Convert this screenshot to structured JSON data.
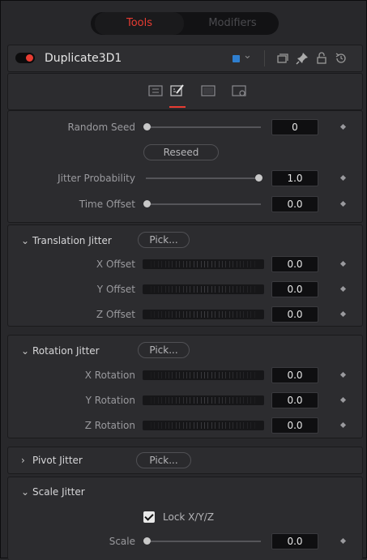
{
  "tabs": {
    "tools": "Tools",
    "modifiers": "Modifiers"
  },
  "header": {
    "title": "Duplicate3D1",
    "color": "#2f7fd0"
  },
  "panel1": {
    "random_seed": {
      "label": "Random Seed",
      "value": "0"
    },
    "reseed": "Reseed",
    "jitter_probability": {
      "label": "Jitter Probability",
      "value": "1.0"
    },
    "time_offset": {
      "label": "Time Offset",
      "value": "0.0"
    }
  },
  "translation": {
    "title": "Translation Jitter",
    "pick": "Pick...",
    "x": {
      "label": "X Offset",
      "value": "0.0"
    },
    "y": {
      "label": "Y Offset",
      "value": "0.0"
    },
    "z": {
      "label": "Z Offset",
      "value": "0.0"
    }
  },
  "rotation": {
    "title": "Rotation Jitter",
    "pick": "Pick...",
    "x": {
      "label": "X Rotation",
      "value": "0.0"
    },
    "y": {
      "label": "Y Rotation",
      "value": "0.0"
    },
    "z": {
      "label": "Z Rotation",
      "value": "0.0"
    }
  },
  "pivot": {
    "title": "Pivot Jitter",
    "pick": "Pick..."
  },
  "scale": {
    "title": "Scale Jitter",
    "lock_label": "Lock X/Y/Z",
    "scale": {
      "label": "Scale",
      "value": "0.0"
    }
  },
  "accent": "#e83c32"
}
